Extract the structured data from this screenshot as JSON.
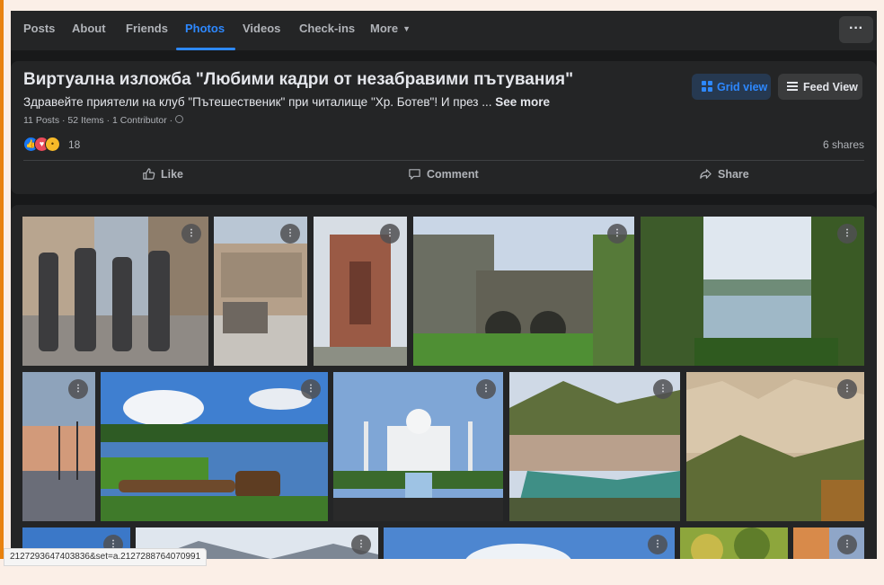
{
  "nav": {
    "tabs": [
      {
        "label": "Posts"
      },
      {
        "label": "About"
      },
      {
        "label": "Friends"
      },
      {
        "label": "Photos",
        "active": true
      },
      {
        "label": "Videos"
      },
      {
        "label": "Check-ins"
      },
      {
        "label": "More"
      }
    ],
    "more_menu_icon": "more-horizontal-icon",
    "more_menu_glyph": "···"
  },
  "album": {
    "title": "Виртуална изложба \"Любими кадри от незабравими пътувания\"",
    "description": "Здравейте приятели на клуб \"Пътешественик\" при читалище \"Хр. Ботев\"! И през ... ",
    "see_more": "See more",
    "meta": "11 Posts · 52 Items · 1 Contributor ·",
    "grid_view_label": "Grid view",
    "feed_view_label": "Feed View",
    "reaction_count": "18",
    "reactions": [
      "like",
      "love",
      "wow"
    ],
    "shares": "6 shares",
    "actions": {
      "like": "Like",
      "comment": "Comment",
      "share": "Share"
    }
  },
  "photos": [
    {
      "name": "photo-beatles-statue"
    },
    {
      "name": "photo-city-square"
    },
    {
      "name": "photo-cathedral"
    },
    {
      "name": "photo-stone-bridge"
    },
    {
      "name": "photo-river-view"
    },
    {
      "name": "photo-harbor-sunset"
    },
    {
      "name": "photo-boats-lake"
    },
    {
      "name": "photo-taj-mahal"
    },
    {
      "name": "photo-river-valley"
    },
    {
      "name": "photo-rock-pyramids"
    },
    {
      "name": "photo-blue-sky"
    },
    {
      "name": "photo-mountains"
    },
    {
      "name": "photo-clouds"
    },
    {
      "name": "photo-trees"
    },
    {
      "name": "photo-cliff"
    }
  ],
  "photo_option_glyph": "⋮",
  "status_url": "2127293647403836&set=a.2127288764070991",
  "colors": {
    "accent": "#2d88ff",
    "surface": "#242526",
    "background": "#18191a"
  }
}
